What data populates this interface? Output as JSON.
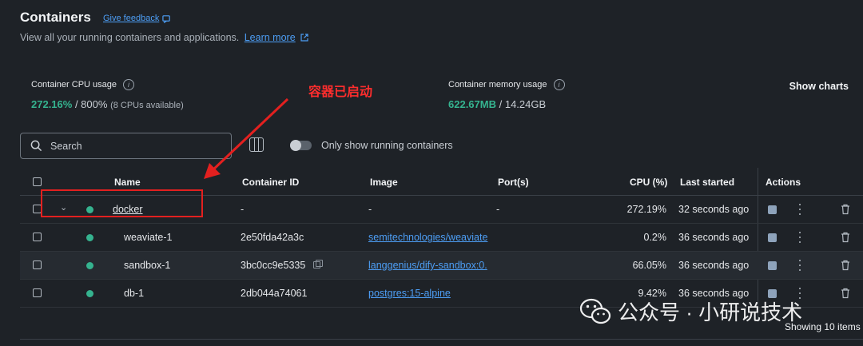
{
  "header": {
    "title": "Containers",
    "feedback_label": "Give feedback",
    "subtitle": "View all your running containers and applications.",
    "learn_more_label": "Learn more"
  },
  "stats": {
    "cpu": {
      "label": "Container CPU usage",
      "value": "272.16%",
      "max": "/ 800%",
      "note": "(8 CPUs available)"
    },
    "memory": {
      "label": "Container memory usage",
      "value": "622.67MB",
      "max": "/ 14.24GB"
    },
    "show_charts_label": "Show charts"
  },
  "annotation": {
    "text": "容器已启动",
    "color": "#e3201f"
  },
  "toolbar": {
    "search_placeholder": "Search",
    "running_only_label": "Only show running containers",
    "running_only_enabled": false
  },
  "table": {
    "headers": {
      "name": "Name",
      "container_id": "Container ID",
      "image": "Image",
      "ports": "Port(s)",
      "cpu": "CPU (%)",
      "last_started": "Last started",
      "actions": "Actions"
    },
    "rows": [
      {
        "name": "docker",
        "container_id": "-",
        "image": "-",
        "ports": "-",
        "cpu": "272.19%",
        "last_started": "32 seconds ago"
      },
      {
        "name": "weaviate-1",
        "container_id": "2e50fda42a3c",
        "image": "semitechnologies/weaviate",
        "ports": "",
        "cpu": "0.2%",
        "last_started": "36 seconds ago"
      },
      {
        "name": "sandbox-1",
        "container_id": "3bc0cc9e5335",
        "image": "langgenius/dify-sandbox:0.",
        "ports": "",
        "cpu": "66.05%",
        "last_started": "36 seconds ago"
      },
      {
        "name": "db-1",
        "container_id": "2db044a74061",
        "image": "postgres:15-alpine",
        "ports": "",
        "cpu": "9.42%",
        "last_started": "36 seconds ago"
      }
    ],
    "footer": "Showing 10 items"
  },
  "watermark": {
    "text": "公众号 · 小研说技术"
  },
  "colors": {
    "background": "#1e2227",
    "accent": "#4d9ef5",
    "running": "#35b38f"
  }
}
